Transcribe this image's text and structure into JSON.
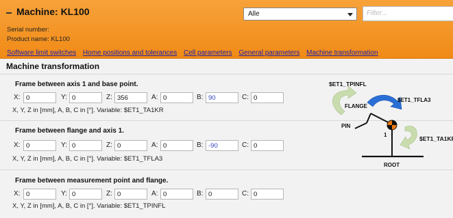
{
  "header": {
    "title": "Machine: KL100",
    "serial_label": "Serial number:",
    "product_label": "Product name: KL100",
    "filter_select": "Alle",
    "filter_placeholder": "Filter..."
  },
  "nav": [
    "Software limit switches",
    "Home positions and tolerances",
    "Cell parameters",
    "General parameters",
    "Machine transformation"
  ],
  "page_title": "Machine transformation",
  "frames": [
    {
      "title": "Frame between axis 1 and base point.",
      "fields": [
        {
          "label": "X:",
          "value": "0"
        },
        {
          "label": "Y:",
          "value": "0"
        },
        {
          "label": "Z:",
          "value": "356"
        },
        {
          "label": "A:",
          "value": "0"
        },
        {
          "label": "B:",
          "value": "90"
        },
        {
          "label": "C:",
          "value": "0"
        }
      ],
      "note": "X, Y, Z in [mm], A, B, C in [°]. Variable: $ET1_TA1KR"
    },
    {
      "title": "Frame between flange and axis 1.",
      "fields": [
        {
          "label": "X:",
          "value": "0"
        },
        {
          "label": "Y:",
          "value": "0"
        },
        {
          "label": "Z:",
          "value": "0"
        },
        {
          "label": "A:",
          "value": "0"
        },
        {
          "label": "B:",
          "value": "-90"
        },
        {
          "label": "C:",
          "value": "0"
        }
      ],
      "note": "X, Y, Z in [mm], A, B, C in [°]. Variable: $ET1_TFLA3"
    },
    {
      "title": "Frame between measurement point and flange.",
      "fields": [
        {
          "label": "X:",
          "value": "0"
        },
        {
          "label": "Y:",
          "value": "0"
        },
        {
          "label": "Z:",
          "value": "0"
        },
        {
          "label": "A:",
          "value": "0"
        },
        {
          "label": "B:",
          "value": "0"
        },
        {
          "label": "C:",
          "value": "0"
        }
      ],
      "note": "X, Y, Z in [mm], A, B, C in [°]. Variable: $ET1_TPINFL"
    }
  ],
  "diagram": {
    "tpinfl": "$ET1_TPINFL",
    "tfla3": "$ET1_TFLA3",
    "ta1kr": "$ET1_TA1KR",
    "flange": "FLANGE",
    "pin": "PIN",
    "axis": "1",
    "root": "ROOT"
  },
  "colors": {
    "header_orange": "#f08a16",
    "link_blue": "#2222aa",
    "arrow_blue": "#2a6fd6",
    "arrow_green": "#c9dcae",
    "origin_orange": "#f07a10"
  }
}
